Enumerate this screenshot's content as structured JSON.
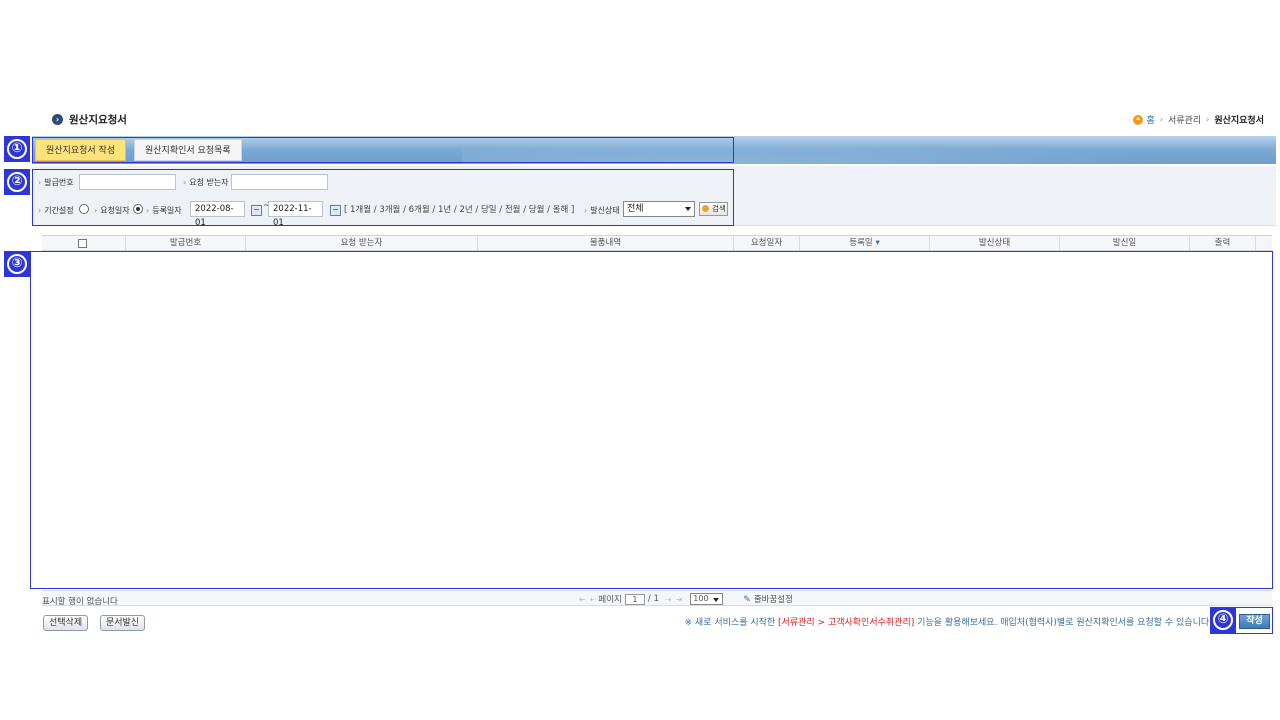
{
  "page": {
    "title": "원산지요청서"
  },
  "breadcrumb": {
    "home": "홈",
    "section": "서류관리",
    "current": "원산지요청서"
  },
  "tabs": [
    {
      "label": "원산지요청서 작성",
      "active": true
    },
    {
      "label": "원산지확인서 요청목록",
      "active": false
    }
  ],
  "search": {
    "issue_no_label": "발급번호",
    "issue_no_value": "",
    "recipient_label": "요청 받는자",
    "recipient_value": "",
    "period_label": "기간설정",
    "request_date_label": "요청일자",
    "register_date_label": "등록일자",
    "date_from": "2022-08-01",
    "date_to": "2022-11-01",
    "tilde": "~",
    "range_links": "[ 1개월 / 3개월 / 6개월 / 1년 / 2년 / 당일 / 전월 / 당월 / 올해 ]",
    "send_status_label": "발신상태",
    "send_status_value": "전체",
    "search_button": "검색"
  },
  "grid": {
    "columns": [
      "발급번호",
      "요청 받는자",
      "물품내역",
      "요청일자",
      "등록일",
      "발신상태",
      "발신일",
      "출력"
    ],
    "sort_indicator": "▾",
    "rows": [],
    "empty_message": "표시할 행이 없습니다"
  },
  "pager": {
    "first": "⇤",
    "prev": "⇠",
    "page_label": "페이지",
    "page_value": "1",
    "total": "/ 1",
    "next": "⇢",
    "last": "⇥",
    "page_size": "100",
    "wrap_setting": "줄바꿈설정"
  },
  "actions": {
    "delete_selected": "선택삭제",
    "send_document": "문서발신",
    "write": "작성"
  },
  "notice": {
    "prefix": "※ 새로 서비스를 시작한 ",
    "highlight": "[서류관리 > 고객사확인서수취관리]",
    "suffix": " 기능을 활용해보세요. 매입처(협력사)별로 원산지확인서를 요청할 수 있습니다."
  },
  "annotations": [
    "①",
    "②",
    "③",
    "④"
  ],
  "colors": {
    "annotation": "#2e36d9",
    "active_tab": "#ffe27a",
    "tab_bar": "#7aa8d4",
    "notice_red": "#e02020"
  }
}
